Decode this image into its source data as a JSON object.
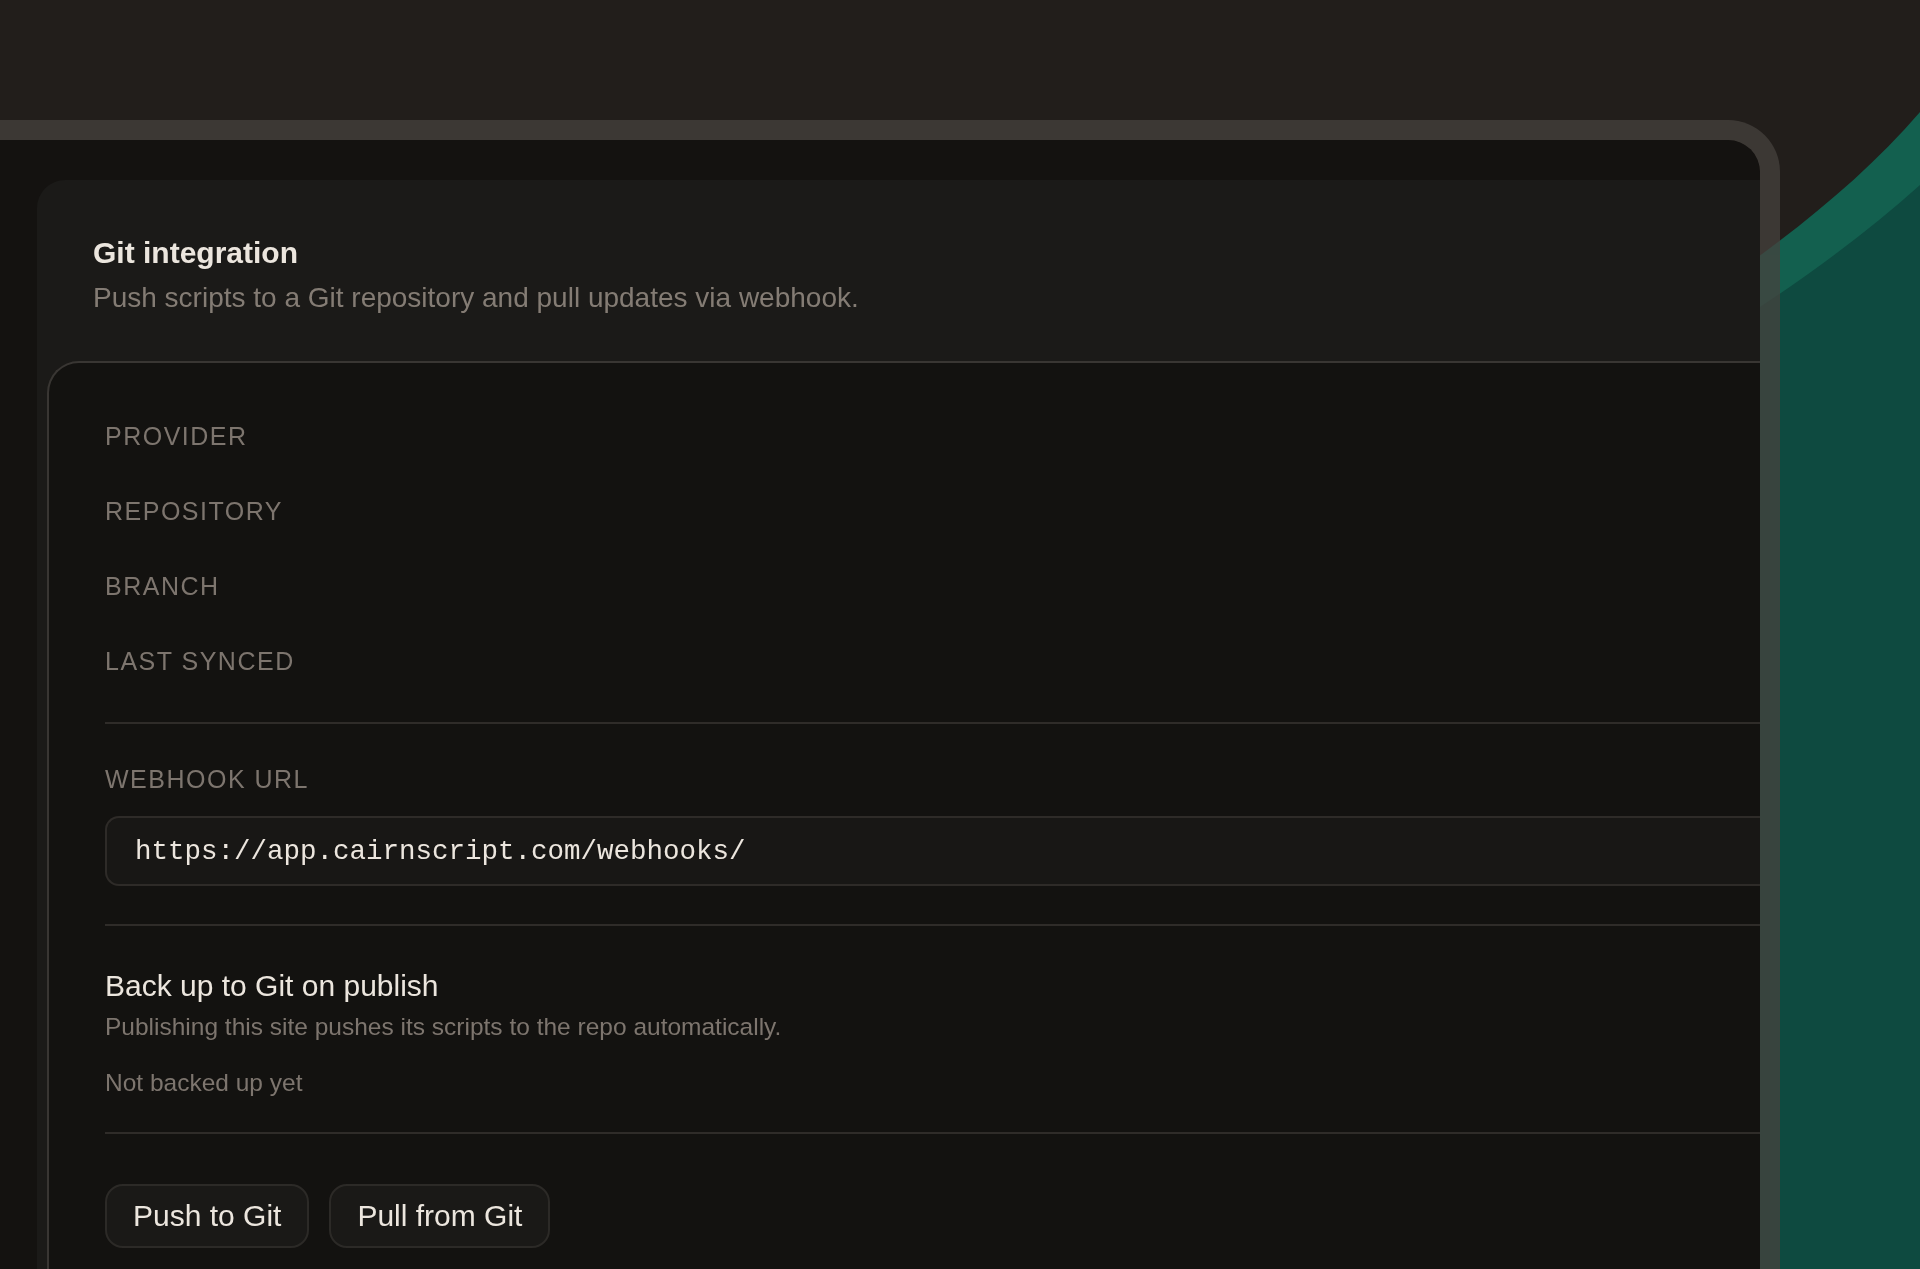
{
  "section": {
    "title": "Git integration",
    "subtitle": "Push scripts to a Git repository and pull updates via webhook."
  },
  "fields": [
    {
      "label": "PROVIDER"
    },
    {
      "label": "REPOSITORY"
    },
    {
      "label": "BRANCH"
    },
    {
      "label": "LAST SYNCED"
    }
  ],
  "webhook": {
    "label": "WEBHOOK URL",
    "value": "https://app.cairnscript.com/webhooks/"
  },
  "backup": {
    "title": "Back up to Git on publish",
    "description": "Publishing this site pushes its scripts to the repo automatically.",
    "status": "Not backed up yet"
  },
  "buttons": [
    "Push to Git",
    "Pull from Git"
  ]
}
